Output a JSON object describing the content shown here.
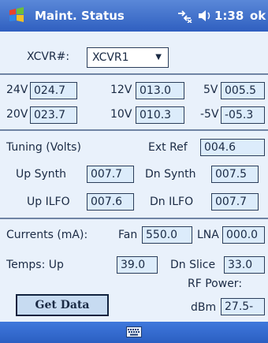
{
  "titlebar": {
    "title": "Maint. Status",
    "time": "1:38",
    "ok": "ok"
  },
  "xcvr": {
    "label": "XCVR#:",
    "value": "XCVR1"
  },
  "voltages": {
    "v24": {
      "label": "24V",
      "value": "024.7"
    },
    "v12": {
      "label": "12V",
      "value": "013.0"
    },
    "v5": {
      "label": "5V",
      "value": "005.5"
    },
    "v20": {
      "label": "20V",
      "value": "023.7"
    },
    "v10": {
      "label": "10V",
      "value": "010.3"
    },
    "vm5": {
      "label": "-5V",
      "value": "-05.3"
    }
  },
  "tuning": {
    "label": "Tuning (Volts)",
    "ext_ref_label": "Ext Ref",
    "ext_ref": "004.6",
    "up_synth_label": "Up Synth",
    "up_synth": "007.7",
    "dn_synth_label": "Dn Synth",
    "dn_synth": "007.5",
    "up_ilfo_label": "Up ILFO",
    "up_ilfo": "007.6",
    "dn_ilfo_label": "Dn ILFO",
    "dn_ilfo": "007.7"
  },
  "currents": {
    "label": "Currents (mA):",
    "fan_label": "Fan",
    "fan": "550.0",
    "lna_label": "LNA",
    "lna": "000.0"
  },
  "temps": {
    "label": "Temps: Up",
    "up": "39.0",
    "dn_label": "Dn Slice",
    "dn": "33.0"
  },
  "rf": {
    "label": "RF Power:",
    "unit": "dBm",
    "value": "27.5-"
  },
  "buttons": {
    "get_data": "Get Data"
  },
  "icons": {
    "start": "windows-start-icon",
    "connectivity": "connectivity-icon",
    "volume": "volume-icon",
    "keyboard": "keyboard-icon"
  }
}
